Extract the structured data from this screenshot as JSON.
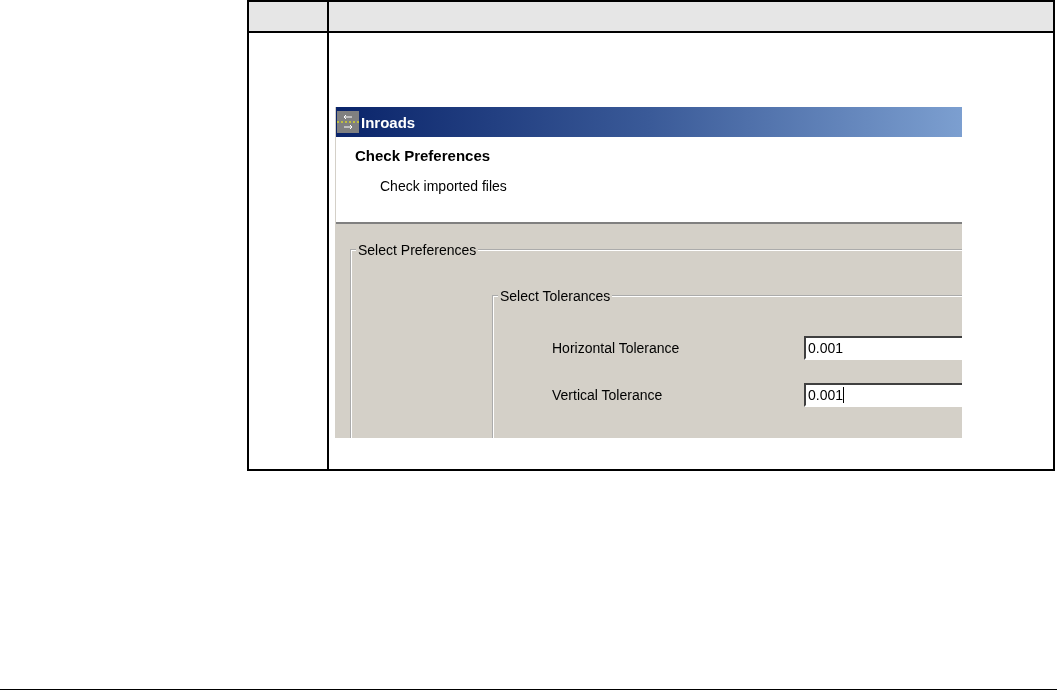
{
  "dialog": {
    "title": "Inroads",
    "heading": "Check Preferences",
    "subheading": "Check imported files",
    "group": {
      "legend": "Select Preferences",
      "subgroup": {
        "legend": "Select Tolerances",
        "fields": [
          {
            "label": "Horizontal Tolerance",
            "value": "0.001",
            "focused": false
          },
          {
            "label": "Vertical Tolerance",
            "value": "0.001",
            "focused": true
          }
        ]
      }
    }
  }
}
